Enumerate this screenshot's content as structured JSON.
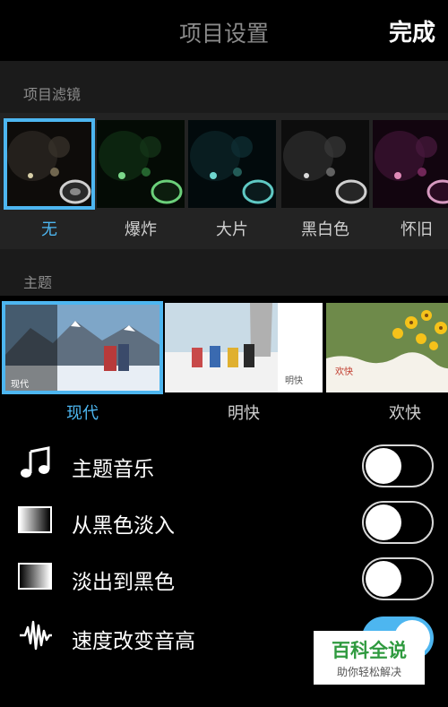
{
  "nav": {
    "title": "项目设置",
    "done_label": "完成"
  },
  "filters": {
    "header": "项目滤镜",
    "items": [
      {
        "label": "无",
        "selected": true
      },
      {
        "label": "爆炸",
        "selected": false
      },
      {
        "label": "大片",
        "selected": false
      },
      {
        "label": "黑白色",
        "selected": false
      },
      {
        "label": "怀旧",
        "selected": false
      }
    ]
  },
  "themes": {
    "header": "主题",
    "items": [
      {
        "label": "现代",
        "tag": "现代",
        "selected": true
      },
      {
        "label": "明快",
        "tag": "明快",
        "selected": false
      },
      {
        "label": "欢快",
        "tag": "欢快",
        "selected": false
      }
    ]
  },
  "settings": [
    {
      "label": "主题音乐",
      "icon": "music-note-icon",
      "on": false
    },
    {
      "label": "从黑色淡入",
      "icon": "fade-in-icon",
      "on": false
    },
    {
      "label": "淡出到黑色",
      "icon": "fade-out-icon",
      "on": false
    },
    {
      "label": "速度改变音高",
      "icon": "waveform-icon",
      "on": true
    }
  ],
  "watermark": {
    "main": "百科全说",
    "sub": "助你轻松解决"
  },
  "colors": {
    "accent": "#4db6f0",
    "header_bg": "#1b1b1b",
    "strip_bg": "#232323"
  }
}
